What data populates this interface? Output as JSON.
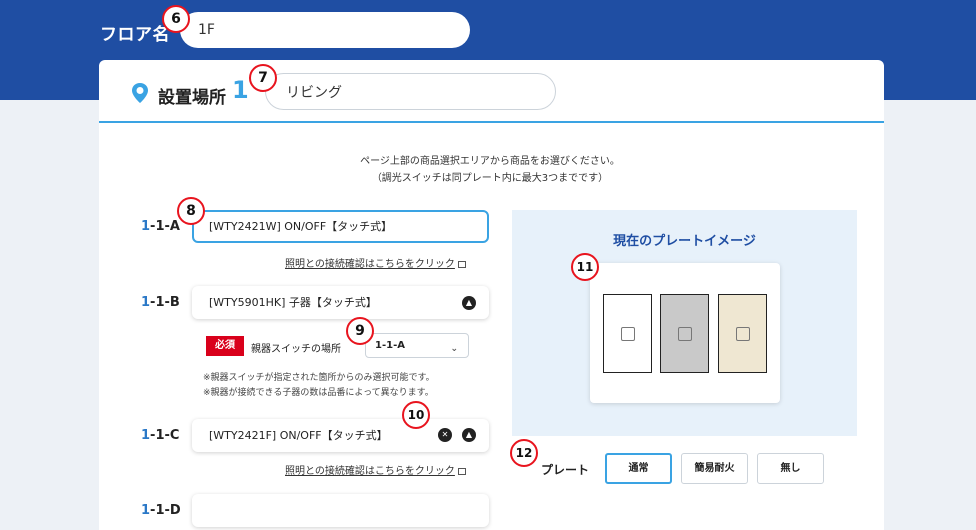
{
  "header": {
    "floor_label": "フロア名",
    "floor_value": "1F"
  },
  "location": {
    "label": "設置場所",
    "number": "1",
    "value": "リビング"
  },
  "instruction": {
    "line1": "ページ上部の商品選択エリアから商品をお選びください。",
    "line2": "（調光スイッチは同プレート内に最大3つまでです）"
  },
  "slots": [
    {
      "prefix": "1",
      "suffix": "-1-A",
      "value": "[WTY2421W] ON/OFF【タッチ式】",
      "link": "照明との接続確認はこちらをクリック"
    },
    {
      "prefix": "1",
      "suffix": "-1-B",
      "value": "[WTY5901HK] 子器【タッチ式】"
    },
    {
      "prefix": "1",
      "suffix": "-1-C",
      "value": "[WTY2421F] ON/OFF【タッチ式】",
      "link": "照明との接続確認はこちらをクリック"
    },
    {
      "prefix": "1",
      "suffix": "-1-D",
      "value": ""
    }
  ],
  "parent": {
    "required": "必須",
    "label": "親器スイッチの場所",
    "selected": "1-1-A"
  },
  "notes": {
    "note1": "※親器スイッチが指定された箇所からのみ選択可能です。",
    "note2": "※親器が接続できる子器の数は品番によって異なります。"
  },
  "preview": {
    "title": "現在のプレートイメージ",
    "plate_colors": [
      "#ffffff",
      "#c9c9c9",
      "#efe7d2"
    ]
  },
  "plate_options": {
    "label": "プレート",
    "options": [
      "通常",
      "簡易耐火",
      "無し"
    ],
    "selected": "通常"
  },
  "badges": [
    "6",
    "7",
    "8",
    "9",
    "10",
    "11",
    "12"
  ],
  "icons": {
    "pin": "location-pin-icon",
    "chevron_up": "chevron-up-icon",
    "close": "close-icon",
    "external": "external-link-icon",
    "chevron_down": "chevron-down-icon"
  }
}
